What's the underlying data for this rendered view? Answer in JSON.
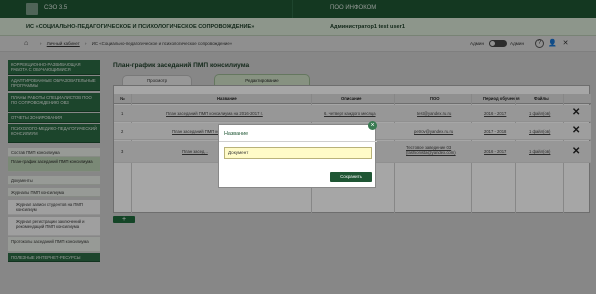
{
  "topbar": {
    "brand": "СЭО 3.5",
    "portal": "ПОО ИНФОКОМ"
  },
  "titlebar": {
    "app_title": "ИС «СОЦИАЛЬНО-ПЕДАГОГИЧЕСКОЕ И ПСИХОЛОГИЧЕСКОЕ СОПРОВОЖДЕНИЕ»",
    "user": "Администратор1 test user1"
  },
  "breadcrumb": {
    "items": [
      "Личный кабинет",
      "ИС «Социально-педагогическое и психологическое сопровождение»"
    ]
  },
  "admin": {
    "left": "Админ",
    "right": "Админ"
  },
  "sidebar": {
    "items": [
      "КОРРЕКЦИОННО-РАЗВИВАЮЩАЯ РАБОТА С ОБУЧАЮЩИМИСЯ",
      "АДАПТИРОВАННЫЕ ОБРАЗОВАТЕЛЬНЫЕ ПРОГРАММЫ",
      "ПЛАНЫ РАБОТЫ СПЕЦИАЛИСТОВ ПОО ПО СОПРОВОЖДЕНИЮ ОВЗ",
      "ОТЧЕТЫ ЗОНИРОВАНИЯ",
      "ПСИХОЛОГО-МЕДИКО-ПЕДАГОГИЧЕСКИЙ КОНСИЛИУМ",
      "Состав ПМП консилиума",
      "План-график заседаний ПМП консилиума",
      "Документы",
      "Журналы ПМП консилиума",
      "Журнал записи студентов на ПМП консилиум",
      "Журнал регистрации заключений и рекомендаций ПМП консилиума",
      "Протоколы заседаний ПМП консилиума",
      "ПОЛЕЗНЫЕ ИНТЕРНЕТ-РЕСУРСЫ"
    ]
  },
  "main": {
    "title": "План-график заседаний ПМП консилиума",
    "tabs": [
      "Просмотр",
      "Редактирование"
    ],
    "table": {
      "headers": [
        "№",
        "Название",
        "Описание",
        "ПОО",
        "Период обучения",
        "Файлы"
      ],
      "rows": [
        {
          "num": "1",
          "name": "План заседаний ПМП консилиума на 2016-2017 г.",
          "desc": "6. четверг каждого месяца",
          "poo": "test@yandex.ru.ru",
          "period": "2016 - 2017",
          "files": "1 файл(ов)"
        },
        {
          "num": "2",
          "name": "План заседаний ПМП консилиума",
          "desc": "",
          "poo": "petrov@yandex.ru.ru",
          "period": "2017 - 2018",
          "files": "1 файл(ов)"
        },
        {
          "num": "3",
          "name": "План засед...",
          "desc": "...ний тест",
          "poo": "Тестовое заведение 03 (fashionista@yandex.com)",
          "period": "2016 - 2017",
          "files": "1 файл(ов)"
        }
      ]
    },
    "add_label": "+"
  },
  "modal": {
    "title": "Название",
    "input_value": "Документ",
    "save_label": "Сохранить",
    "close": "×"
  },
  "icons": {
    "home": "⌂",
    "question": "?",
    "user": "👤",
    "close": "✕"
  }
}
